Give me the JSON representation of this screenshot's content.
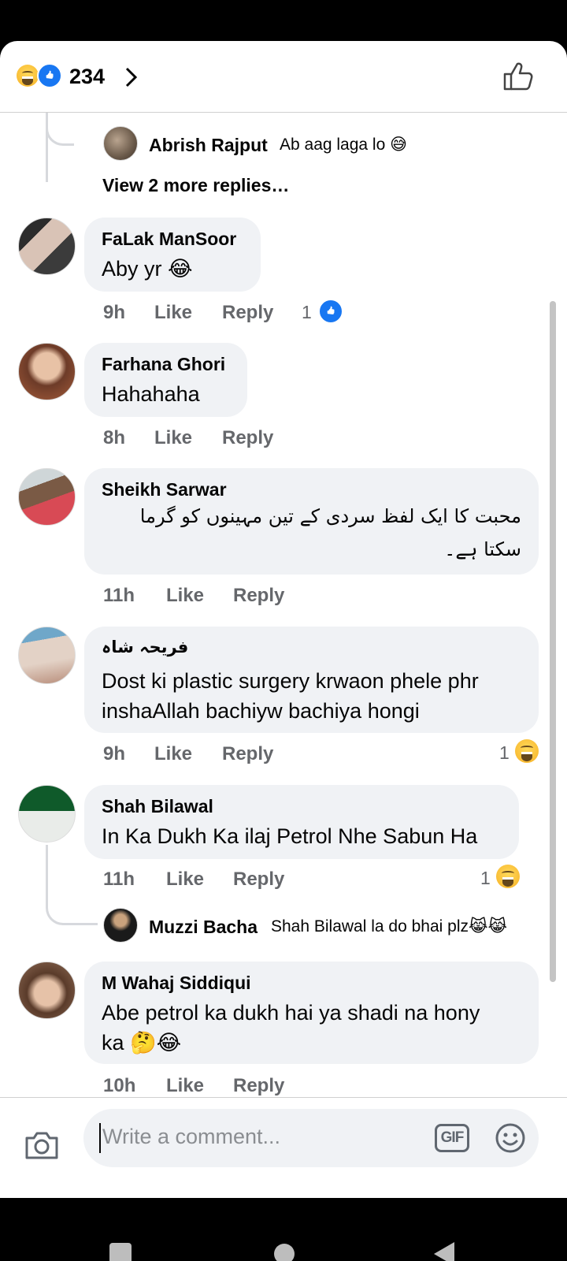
{
  "header": {
    "reaction_icons": [
      "haha-emoji-icon",
      "like-emoji-icon"
    ],
    "reaction_count": "234",
    "like_icon": "thumbs-up-outline-icon"
  },
  "thread_top": {
    "reply": {
      "name": "Abrish Rajput",
      "text": "Ab aag laga lo 😅"
    },
    "view_more": "View 2 more replies…"
  },
  "comments": [
    {
      "name": "FaLak ManSoor",
      "text": "Aby yr 😂",
      "time": "9h",
      "like": "Like",
      "reply": "Reply",
      "react_count": "1",
      "react_icon": "like-emoji-icon"
    },
    {
      "name": "Farhana Ghori",
      "text": "Hahahaha",
      "time": "8h",
      "like": "Like",
      "reply": "Reply"
    },
    {
      "name": "Sheikh Sarwar",
      "text_lines": [
        "محبت کا ایک لفظ سردی کے تین مہینوں کو گرما",
        "سکتا ہے۔"
      ],
      "time": "11h",
      "like": "Like",
      "reply": "Reply"
    },
    {
      "name": "فریحہ شاہ",
      "text_lines": [
        "Dost ki plastic surgery krwaon phele phr",
        "inshaAllah bachiyw bachiya hongi"
      ],
      "time": "9h",
      "like": "Like",
      "reply": "Reply",
      "react_count": "1",
      "react_icon": "haha-emoji-icon"
    },
    {
      "name": "Shah Bilawal",
      "text": "In Ka Dukh Ka ilaj Petrol Nhe Sabun Ha",
      "time": "11h",
      "like": "Like",
      "reply": "Reply",
      "react_count": "1",
      "react_icon": "haha-emoji-icon",
      "reply_preview": {
        "name": "Muzzi Bacha",
        "text": "Shah Bilawal la do bhai plz😹😹"
      }
    },
    {
      "name": "M Wahaj Siddiqui",
      "text_lines": [
        "Abe petrol ka dukh hai ya shadi na hony",
        "ka 🤔😂"
      ],
      "time": "10h",
      "like": "Like",
      "reply": "Reply"
    }
  ],
  "composer": {
    "placeholder": "Write a comment...",
    "gif_label": "GIF"
  },
  "colors": {
    "accent": "#1877f2",
    "bubble": "#f0f2f5",
    "meta": "#65676b",
    "haha": "#f7b125"
  }
}
